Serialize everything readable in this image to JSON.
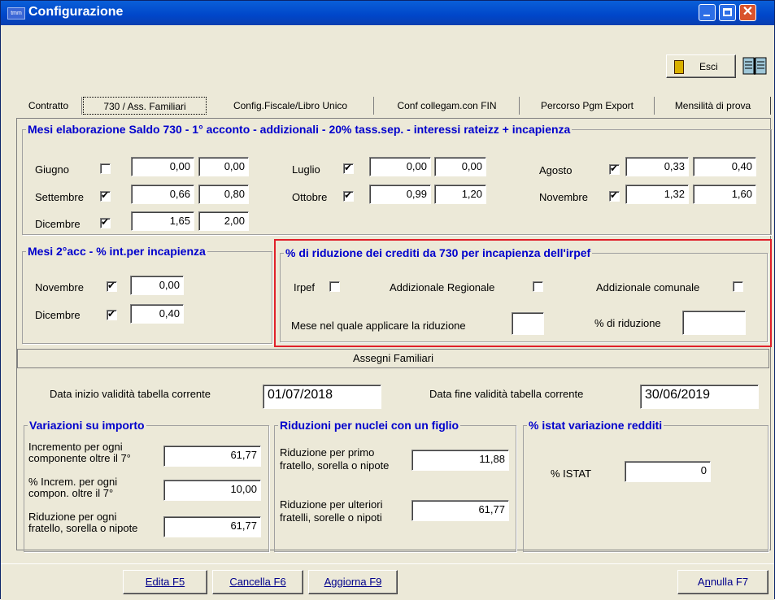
{
  "window": {
    "title": "Configurazione",
    "icon_text": "tmm",
    "close_glyph": "✕"
  },
  "toolbar": {
    "exit_label": "Esci"
  },
  "tabs": [
    "Contratto",
    "730 / Ass. Familiari",
    "Config.Fiscale/Libro Unico",
    "Conf collegam.con FIN",
    "Percorso Pgm Export",
    "Mensilità di prova"
  ],
  "mesi_saldo": {
    "legend": "Mesi elaborazione Saldo 730 - 1° acconto - addizionali - 20% tass.sep. - interessi rateizz + incapienza",
    "rows": [
      {
        "label": "Giugno",
        "checked": false,
        "v1": "0,00",
        "v2": "0,00"
      },
      {
        "label": "Luglio",
        "checked": true,
        "v1": "0,00",
        "v2": "0,00"
      },
      {
        "label": "Agosto",
        "checked": true,
        "v1": "0,33",
        "v2": "0,40"
      },
      {
        "label": "Settembre",
        "checked": true,
        "v1": "0,66",
        "v2": "0,80"
      },
      {
        "label": "Ottobre",
        "checked": true,
        "v1": "0,99",
        "v2": "1,20"
      },
      {
        "label": "Novembre",
        "checked": true,
        "v1": "1,32",
        "v2": "1,60"
      },
      {
        "label": "Dicembre",
        "checked": true,
        "v1": "1,65",
        "v2": "2,00"
      }
    ]
  },
  "mesi_2acc": {
    "legend": "Mesi 2°acc - % int.per incapienza",
    "rows": [
      {
        "label": "Novembre",
        "checked": true,
        "value": "0,00"
      },
      {
        "label": "Dicembre",
        "checked": true,
        "value": "0,40"
      }
    ]
  },
  "riduzione_crediti": {
    "legend": "% di riduzione dei crediti da 730 per incapienza dell'irpef",
    "irpef_label": "Irpef",
    "add_reg_label": "Addizionale Regionale",
    "add_com_label": "Addizionale comunale",
    "mese_label": "Mese nel quale applicare la riduzione",
    "mese_value": "",
    "perc_label": "% di riduzione",
    "perc_value": ""
  },
  "assegni": {
    "title": "Assegni Familiari",
    "data_inizio_label": "Data inizio validità tabella corrente",
    "data_inizio_value": "01/07/2018",
    "data_fine_label": "Data fine validità tabella corrente",
    "data_fine_value": "30/06/2019"
  },
  "variazioni": {
    "legend": "Variazioni su importo",
    "incremento_label_1": "Incremento per ogni",
    "incremento_label_2": "componente oltre il 7°",
    "incremento_value": "61,77",
    "perc_label_1": "% Increm. per ogni",
    "perc_label_2": "compon. oltre il 7°",
    "perc_value": "10,00",
    "riduzione_label_1": "Riduzione per ogni",
    "riduzione_label_2": "fratello, sorella o nipote",
    "riduzione_value": "61,77"
  },
  "riduzioni_nuclei": {
    "legend": "Riduzioni per nuclei con un figlio",
    "primo_label_1": "Riduzione per primo",
    "primo_label_2": "fratello, sorella o nipote",
    "primo_value": "11,88",
    "ulteriori_label_1": "Riduzione per ulteriori",
    "ulteriori_label_2": "fratelli, sorelle o nipoti",
    "ulteriori_value": "61,77"
  },
  "istat": {
    "legend": "% istat variazione redditi",
    "label": "% ISTAT",
    "value": "0"
  },
  "bottom": {
    "edita_u": "E",
    "edita_rest": "dita  F5",
    "cancella_u": "C",
    "cancella_rest": "ancella  F6",
    "aggiorna_u": "A",
    "aggiorna_rest": "ggiorna  F9",
    "annulla_pre": "A",
    "annulla_u": "n",
    "annulla_rest": "nulla  F7"
  }
}
